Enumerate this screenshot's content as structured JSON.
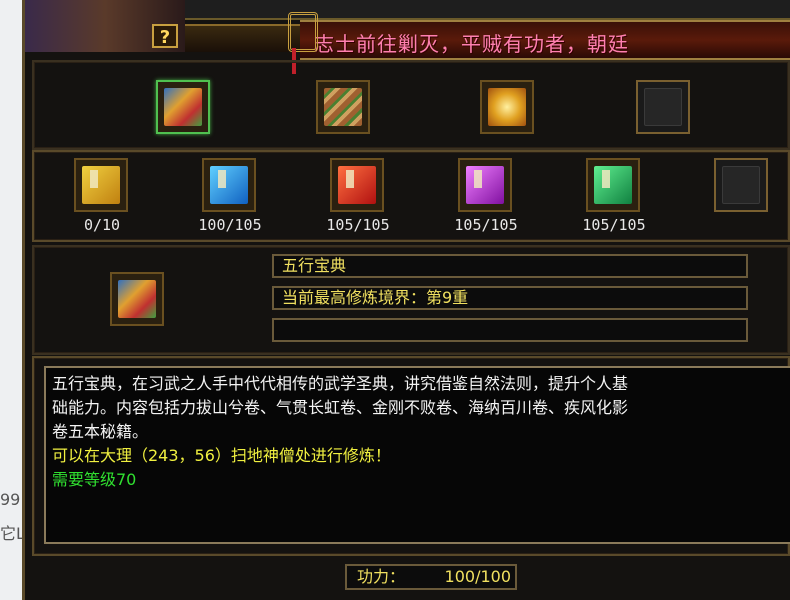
{
  "marquee": "志士前往剿灭，平贼有功者，朝廷",
  "help_label": "?",
  "side_text": [
    "99",
    "它L"
  ],
  "top_items": [
    {
      "name": "book-scroll-icon",
      "selected": true
    },
    {
      "name": "bamboo-scroll-icon",
      "selected": false
    },
    {
      "name": "golden-scroll-icon",
      "selected": false
    },
    {
      "name": "empty-slot",
      "selected": false
    }
  ],
  "volumes": [
    {
      "counter": "0/10",
      "color": "#e8b020"
    },
    {
      "counter": "100/105",
      "color": "#30a8e0"
    },
    {
      "counter": "105/105",
      "color": "#e04020"
    },
    {
      "counter": "105/105",
      "color": "#c040d0"
    },
    {
      "counter": "105/105",
      "color": "#30c060"
    }
  ],
  "detail": {
    "title": "五行宝典",
    "realm": "当前最高修炼境界：第9重",
    "extra": ""
  },
  "description": {
    "line1": "五行宝典，在习武之人手中代代相传的武学圣典，讲究借鉴自然法则，提升个人基",
    "line2": "础能力。内容包括力拔山兮卷、气贯长虹卷、金刚不败卷、海纳百川卷、疾风化影",
    "line3": "卷五本秘籍。",
    "location": "可以在大理（243，56）扫地神僧处进行修炼！",
    "level": "需要等级70"
  },
  "power": {
    "label": "功力：",
    "value": "100/100"
  },
  "colors": {
    "accent_gold": "#c8a040",
    "text_yellow": "#f0f040",
    "text_green": "#30e030"
  }
}
